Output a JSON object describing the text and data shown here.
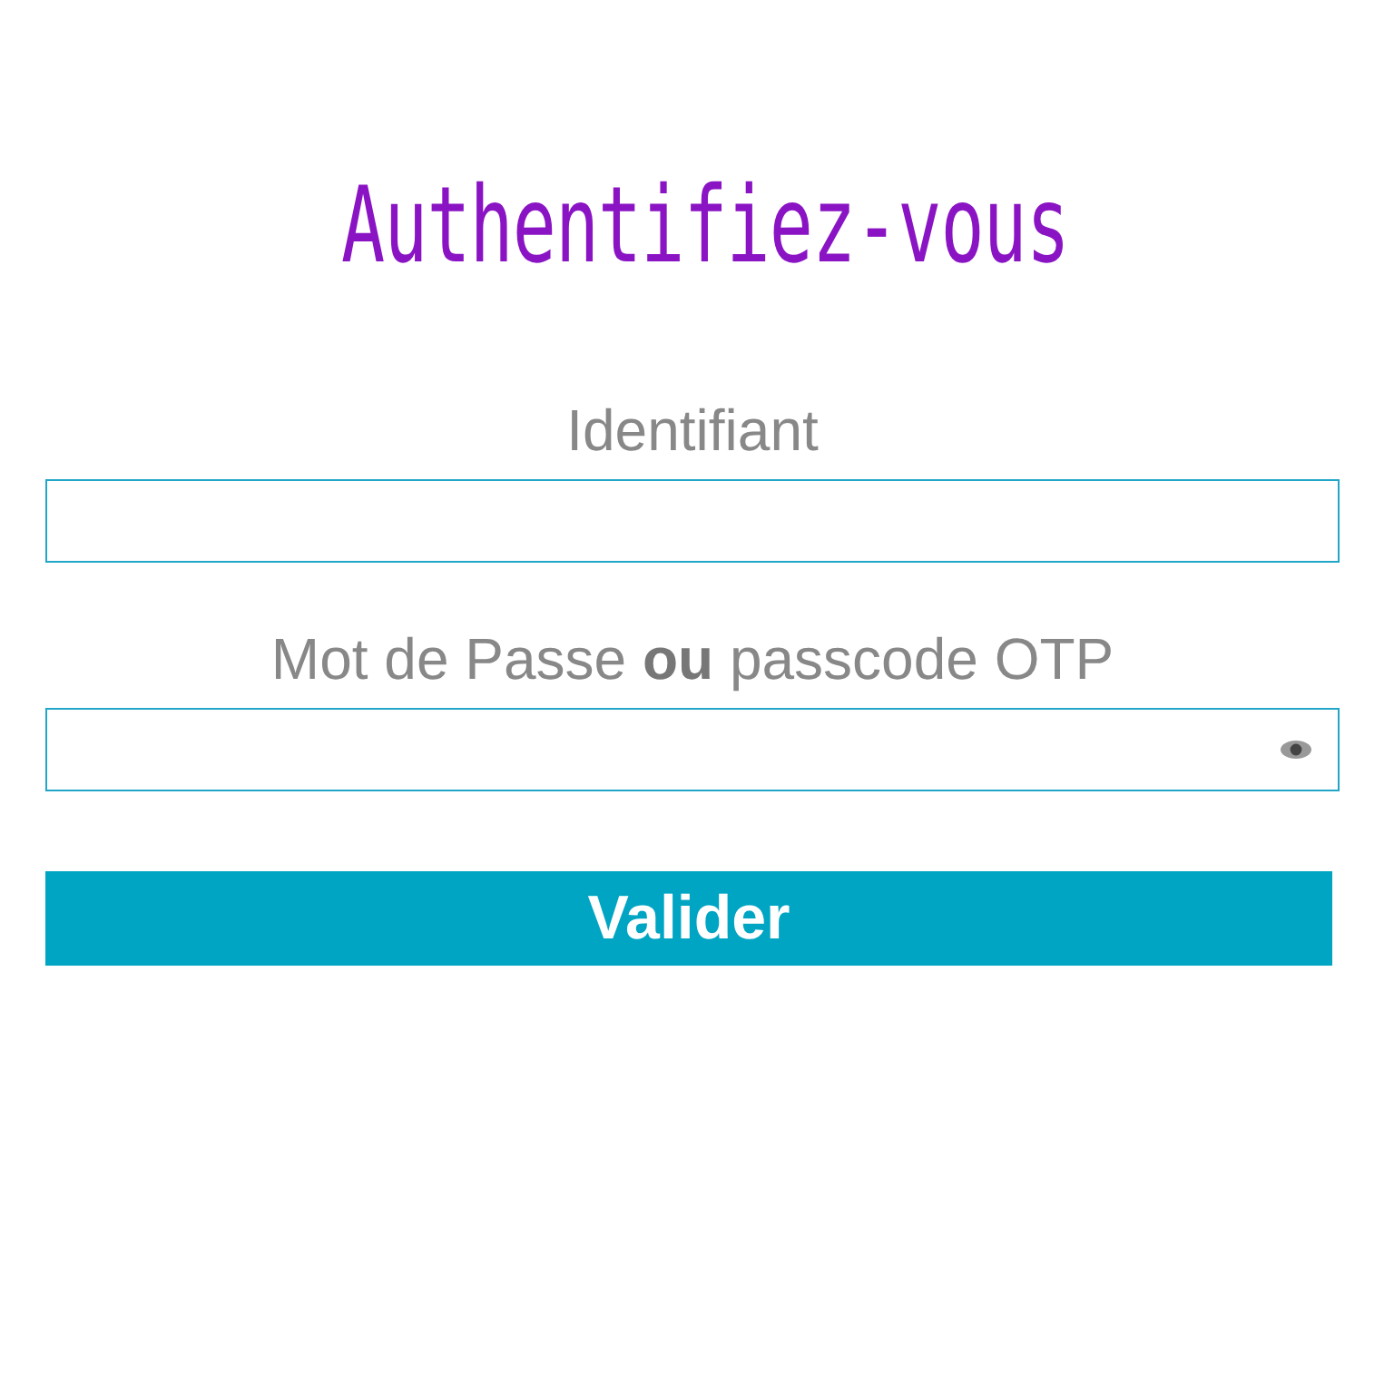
{
  "title": "Authentifiez-vous",
  "fields": [
    {
      "kind": "text",
      "label": "Identifiant"
    },
    {
      "kind": "password",
      "label": "Mot de Passe **ou** passcode OTP"
    }
  ],
  "submit": "Valider"
}
